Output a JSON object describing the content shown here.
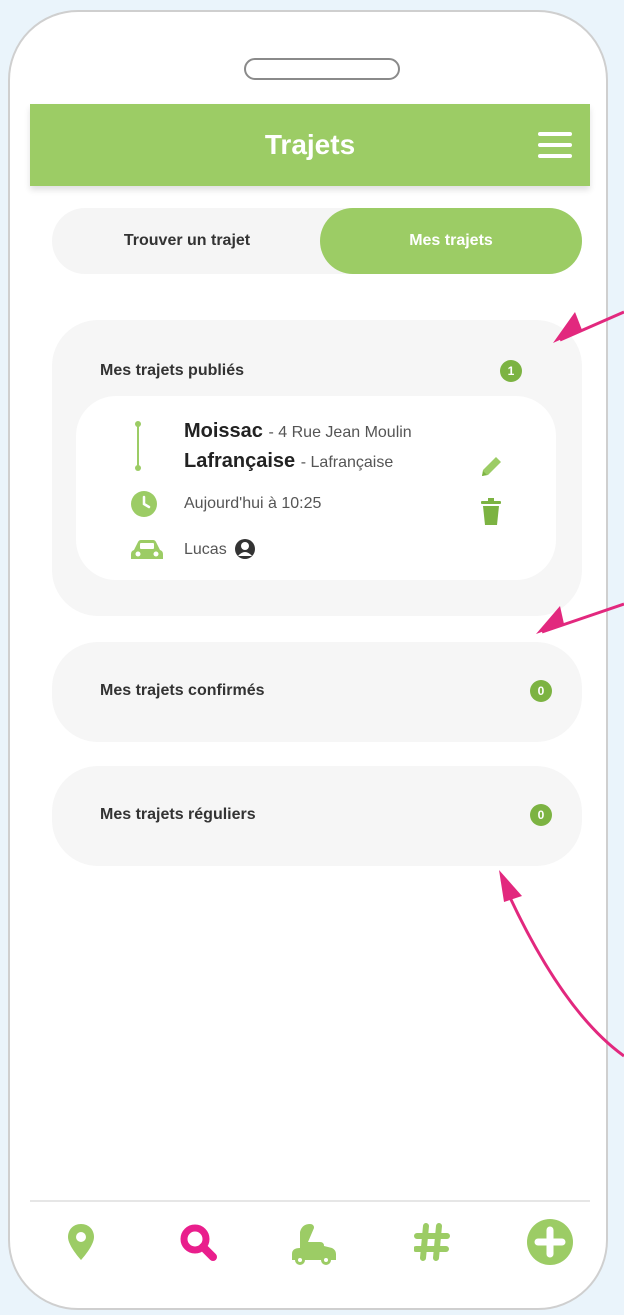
{
  "header": {
    "title": "Trajets"
  },
  "tabs": [
    {
      "label": "Trouver un trajet",
      "active": false
    },
    {
      "label": "Mes trajets",
      "active": true
    }
  ],
  "sections": {
    "published": {
      "title": "Mes trajets publiés",
      "count": "1",
      "trip": {
        "from_city": "Moissac",
        "from_address": "4 Rue Jean Moulin",
        "to_city": "Lafrançaise",
        "to_address": "Lafrançaise",
        "time": "Aujourd'hui à 10:25",
        "driver": "Lucas"
      }
    },
    "confirmed": {
      "title": "Mes trajets confirmés",
      "count": "0"
    },
    "regular": {
      "title": "Mes trajets réguliers",
      "count": "0"
    }
  },
  "nav": [
    {
      "icon": "map-pin-icon",
      "active": false
    },
    {
      "icon": "search-icon",
      "active": true
    },
    {
      "icon": "hitchhike-icon",
      "active": false
    },
    {
      "icon": "hashtag-icon",
      "active": false
    },
    {
      "icon": "add-circle-icon",
      "active": false
    }
  ],
  "colors": {
    "brand_green": "#9ccc65",
    "badge_green": "#7cb342",
    "active_pink": "#e91e8c",
    "annotation_arrow": "#e2287e"
  }
}
